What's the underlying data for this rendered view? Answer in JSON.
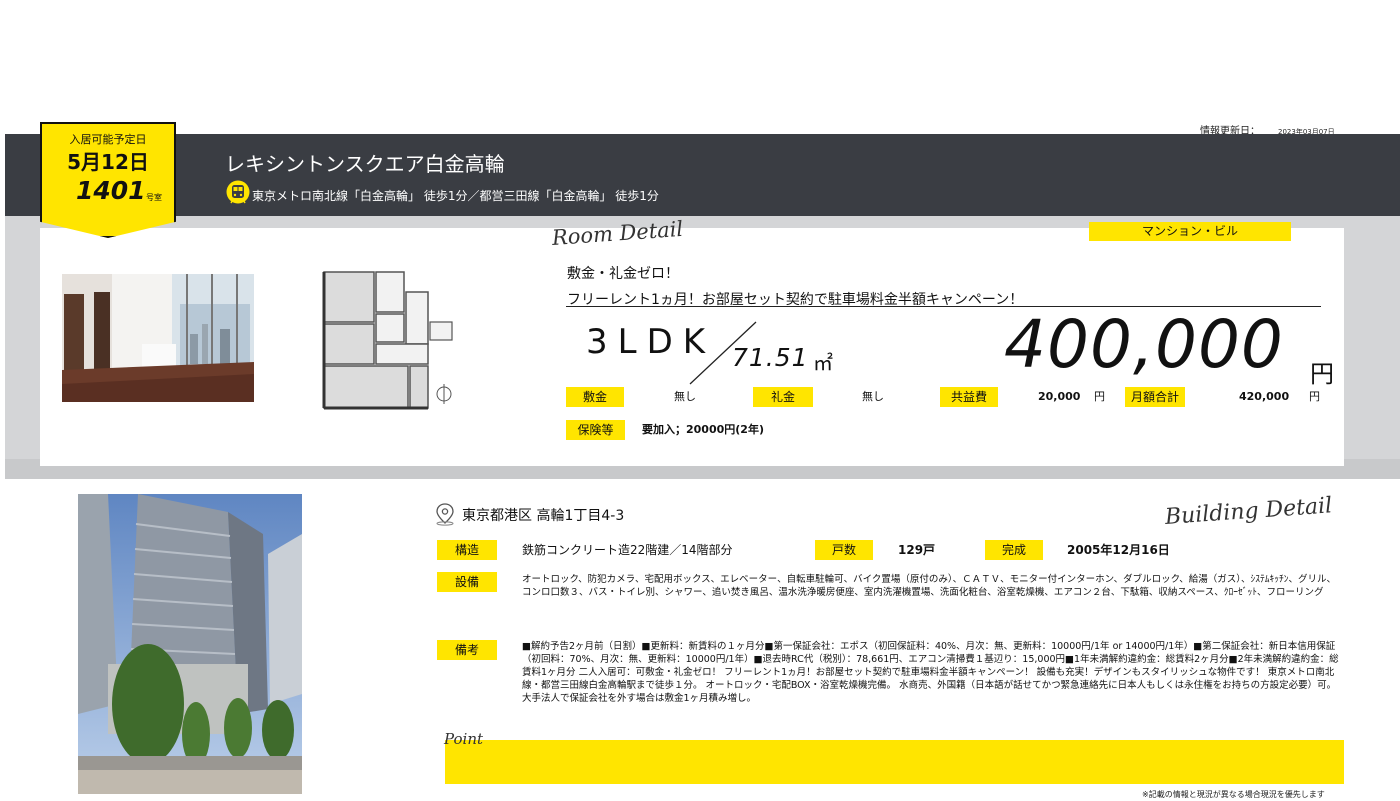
{
  "update": {
    "label": "情報更新日：",
    "date": "2023年03月07日"
  },
  "badge": {
    "label": "入居可能予定日",
    "date": "5月12日",
    "room": "1401",
    "room_suffix": "号室"
  },
  "building": {
    "name": "レキシントンスクエア白金高輪",
    "access": "東京メトロ南北線「白金高輪」 徒歩1分／都営三田線「白金高輪」 徒歩1分",
    "address": "東京都港区 高輪1丁目4-3"
  },
  "room_detail": {
    "script": "Room Detail",
    "type": "マンション・ビル",
    "catch1": "敷金・礼金ゼロ！",
    "catch2": "フリーレント1ヵ月！お部屋セット契約で駐車場料金半額キャンペーン！",
    "layout": "3LDK",
    "area": "71.51",
    "area_unit": "㎡",
    "rent": "400,000",
    "rent_unit": "円"
  },
  "fees": {
    "deposit": {
      "label": "敷金",
      "value": "無し"
    },
    "key_money": {
      "label": "礼金",
      "value": "無し"
    },
    "common": {
      "label": "共益費",
      "value": "20,000",
      "unit": "円"
    },
    "total": {
      "label": "月額合計",
      "value": "420,000",
      "unit": "円"
    },
    "insurance": {
      "label": "保険等",
      "value": "要加入；20000円(2年)"
    }
  },
  "building_detail": {
    "script": "Building Detail",
    "structure_label": "構造",
    "structure": "鉄筋コンクリート造22階建／14階部分",
    "units_label": "戸数",
    "units": "129戸",
    "completed_label": "完成",
    "completed": "2005年12月16日",
    "equipment_label": "設備",
    "equipment": "オートロック、防犯カメラ、宅配用ボックス、エレベーター、自転車駐輪可、バイク置場（原付のみ）、ＣＡＴＶ、モニター付インターホン、ダブルロック、給湯（ガス）、ｼｽﾃﾑｷｯﾁﾝ、グリル、コンロ口数３、バス・トイレ別、シャワー、追い焚き風呂、温水洗浄暖房便座、室内洗濯機置場、洗面化粧台、浴室乾燥機、エアコン２台、下駄箱、収納スペース、ｸﾛｰｾﾞｯﾄ、フローリング",
    "remarks_label": "備考",
    "remarks": "■解約予告2ヶ月前（日割）■更新料：新賃料の１ヶ月分■第一保証会社：エポス（初回保証料：40%、月次：無、更新料：10000円/1年 or 14000円/1年）■第二保証会社：新日本信用保証（初回料：70%、月次：無、更新料：10000円/1年）■退去時RC代（税別）：78,661円、エアコン清掃費１基辺り：15,000円■1年未満解約違約金：総賃料2ヶ月分■2年未満解約違約金：総賃料1ヶ月分 二人入居可：可敷金・礼金ゼロ！ フリーレント1ヵ月！お部屋セット契約で駐車場料金半額キャンペーン！ 設備も充実！デザインもスタイリッシュな物件です！ 東京メトロ南北線・都営三田線白金高輪駅まで徒歩１分。 オートロック・宅配BOX・浴室乾燥機完備。 水商売、外国籍（日本語が話せてかつ緊急連絡先に日本人もしくは永住権をお持ちの方設定必要）可。大手法人で保証会社を外す場合は敷金1ヶ月積み増し。"
  },
  "point": {
    "script": "Point"
  },
  "footnote": "※記載の情報と現況が異なる場合現況を優先します",
  "colors": {
    "accent": "#ffe500",
    "header": "#3a3d43",
    "frame": "#d4d5d7"
  },
  "icons": {
    "train": "train-icon",
    "pin": "map-pin-icon"
  }
}
